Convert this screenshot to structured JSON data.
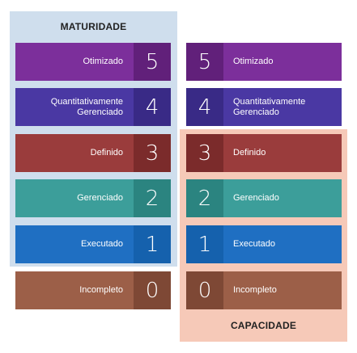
{
  "maturity_title": "MATURIDADE",
  "capability_title": "CAPACIDADE",
  "levels": [
    {
      "level": "5",
      "label": "Otimizado",
      "color": "#7c2f9b",
      "num_color": "#61207a"
    },
    {
      "level": "4",
      "label": "Quantitativamente\nGerenciado",
      "color": "#4a38a3",
      "num_color": "#392a86"
    },
    {
      "level": "3",
      "label": "Definido",
      "color": "#9a3c3c",
      "num_color": "#7b2b2b"
    },
    {
      "level": "2",
      "label": "Gerenciado",
      "color": "#3c9e9a",
      "num_color": "#2b8480"
    },
    {
      "level": "1",
      "label": "Executado",
      "color": "#1f6fc2",
      "num_color": "#1561ad"
    },
    {
      "level": "0",
      "label": "Incompleto",
      "color": "#9c5f48",
      "num_color": "#7e4835"
    }
  ]
}
